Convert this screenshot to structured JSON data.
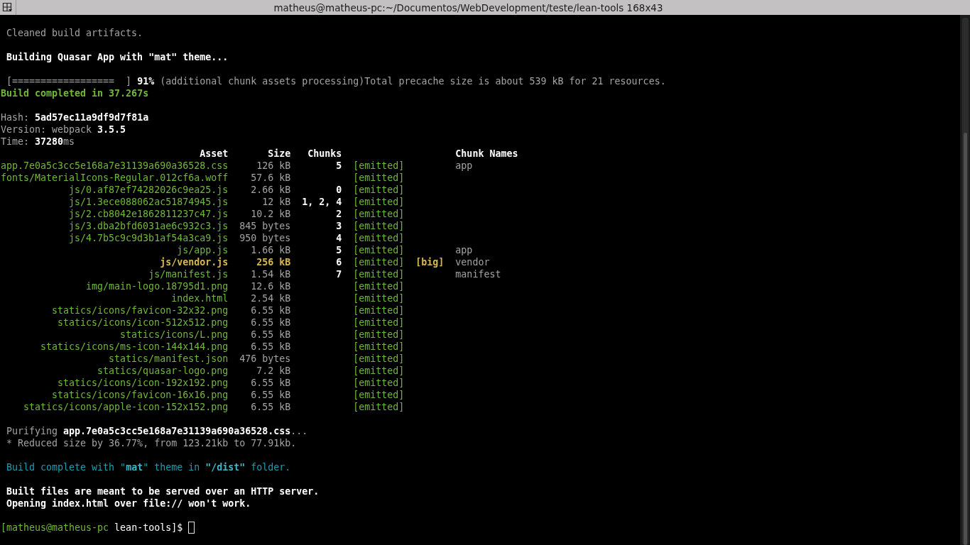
{
  "window": {
    "title": "matheus@matheus-pc:~/Documentos/WebDevelopment/teste/lean-tools 168x43"
  },
  "output": [
    {
      "lines": [
        {
          "kind": "message",
          "segments": [
            {
              "kind": "plain",
              "text": "Cleaned build artifacts."
            }
          ]
        }
      ]
    },
    {
      "lines": [
        {
          "kind": "message",
          "segments": [
            {
              "kind": "emphasis",
              "text": "Building Quasar App with \"mat\" theme..."
            }
          ]
        }
      ]
    },
    {
      "lines": [
        {
          "kind": "message",
          "segments": [
            {
              "kind": "plain",
              "text": "[==================  ] "
            },
            {
              "kind": "emphasis",
              "text": "91%"
            },
            {
              "kind": "plain",
              "text": " (additional chunk assets processing)Total precache size is about 539 kB for 21 resources."
            }
          ]
        },
        {
          "kind": "summary",
          "segments": [
            {
              "kind": "success",
              "text": "Build completed in 37.267s"
            }
          ]
        }
      ]
    },
    {
      "lines": [
        {
          "kind": "summary",
          "segments": [
            {
              "kind": "plain",
              "text": "Hash: "
            },
            {
              "kind": "emphasis",
              "text": "5ad57ec11a9df9d7f81a"
            }
          ]
        },
        {
          "kind": "summary",
          "segments": [
            {
              "kind": "plain",
              "text": "Version: webpack "
            },
            {
              "kind": "emphasis",
              "text": "3.5.5"
            }
          ]
        },
        {
          "kind": "summary",
          "segments": [
            {
              "kind": "plain",
              "text": "Time: "
            },
            {
              "kind": "emphasis",
              "text": "37280"
            },
            {
              "kind": "plain",
              "text": "ms"
            }
          ]
        }
      ],
      "asset_table": {
        "columns": [
          "Asset",
          "Size",
          "Chunks",
          "Chunk Names"
        ],
        "rows": [
          {
            "asset": "app.7e0a5c3cc5e168a7e31139a690a36528.css",
            "size": "126 kB",
            "chunks": "5",
            "status": "[emitted]",
            "oversized": false,
            "chunk_names": "app"
          },
          {
            "asset": "fonts/MaterialIcons-Regular.012cf6a.woff",
            "size": "57.6 kB",
            "status": "[emitted]",
            "oversized": false
          },
          {
            "asset": "js/0.af87ef74282026c9ea25.js",
            "size": "2.66 kB",
            "chunks": "0",
            "status": "[emitted]",
            "oversized": false
          },
          {
            "asset": "js/1.3ece088062ac51874945.js",
            "size": "12 kB",
            "chunks": "1, 2, 4",
            "status": "[emitted]",
            "oversized": false
          },
          {
            "asset": "js/2.cb8042e1862811237c47.js",
            "size": "10.2 kB",
            "chunks": "2",
            "status": "[emitted]",
            "oversized": false
          },
          {
            "asset": "js/3.dba2bfd6031ae6c932c3.js",
            "size": "845 bytes",
            "chunks": "3",
            "status": "[emitted]",
            "oversized": false
          },
          {
            "asset": "js/4.7b5c9c9d3b1af54a3ca9.js",
            "size": "950 bytes",
            "chunks": "4",
            "status": "[emitted]",
            "oversized": false
          },
          {
            "asset": "js/app.js",
            "size": "1.66 kB",
            "chunks": "5",
            "status": "[emitted]",
            "oversized": false,
            "chunk_names": "app"
          },
          {
            "asset": "js/vendor.js",
            "size": "256 kB",
            "chunks": "6",
            "status": "[emitted]",
            "oversized": true,
            "flag": "[big]",
            "chunk_names": "vendor"
          },
          {
            "asset": "js/manifest.js",
            "size": "1.54 kB",
            "chunks": "7",
            "status": "[emitted]",
            "oversized": false,
            "chunk_names": "manifest"
          },
          {
            "asset": "img/main-logo.18795d1.png",
            "size": "12.6 kB",
            "status": "[emitted]",
            "oversized": false
          },
          {
            "asset": "index.html",
            "size": "2.54 kB",
            "status": "[emitted]",
            "oversized": false
          },
          {
            "asset": "statics/icons/favicon-32x32.png",
            "size": "6.55 kB",
            "status": "[emitted]",
            "oversized": false
          },
          {
            "asset": "statics/icons/icon-512x512.png",
            "size": "6.55 kB",
            "status": "[emitted]",
            "oversized": false
          },
          {
            "asset": "statics/icons/L.png",
            "size": "6.55 kB",
            "status": "[emitted]",
            "oversized": false
          },
          {
            "asset": "statics/icons/ms-icon-144x144.png",
            "size": "6.55 kB",
            "status": "[emitted]",
            "oversized": false
          },
          {
            "asset": "statics/manifest.json",
            "size": "476 bytes",
            "status": "[emitted]",
            "oversized": false
          },
          {
            "asset": "statics/quasar-logo.png",
            "size": "7.2 kB",
            "status": "[emitted]",
            "oversized": false
          },
          {
            "asset": "statics/icons/icon-192x192.png",
            "size": "6.55 kB",
            "status": "[emitted]",
            "oversized": false
          },
          {
            "asset": "statics/icons/favicon-16x16.png",
            "size": "6.55 kB",
            "status": "[emitted]",
            "oversized": false
          },
          {
            "asset": "statics/icons/apple-icon-152x152.png",
            "size": "6.55 kB",
            "status": "[emitted]",
            "oversized": false
          }
        ]
      }
    },
    {
      "lines": [
        {
          "kind": "message",
          "segments": [
            {
              "kind": "plain",
              "text": "Purifying "
            },
            {
              "kind": "emphasis",
              "text": "app.7e0a5c3cc5e168a7e31139a690a36528.css"
            },
            {
              "kind": "plain",
              "text": "..."
            }
          ]
        },
        {
          "kind": "message",
          "segments": [
            {
              "kind": "plain",
              "text": "* Reduced size by 36.77%, from 123.21kb to 77.91kb."
            }
          ]
        }
      ]
    },
    {
      "lines": [
        {
          "kind": "message",
          "segments": [
            {
              "kind": "info",
              "text": "Build complete with \""
            },
            {
              "kind": "highlight",
              "text": "mat"
            },
            {
              "kind": "info",
              "text": "\" theme in "
            },
            {
              "kind": "highlight",
              "text": "\"/dist\""
            },
            {
              "kind": "info",
              "text": " folder."
            }
          ]
        }
      ]
    },
    {
      "lines": [
        {
          "kind": "message",
          "segments": [
            {
              "kind": "emphasis",
              "text": "Built files are meant to be served over an HTTP server."
            }
          ]
        },
        {
          "kind": "message",
          "segments": [
            {
              "kind": "emphasis",
              "text": "Opening index.html over file:// won't work."
            }
          ]
        }
      ]
    }
  ],
  "prompt": {
    "user_host": "[matheus@matheus-pc",
    "directory": "lean-tools]$"
  }
}
